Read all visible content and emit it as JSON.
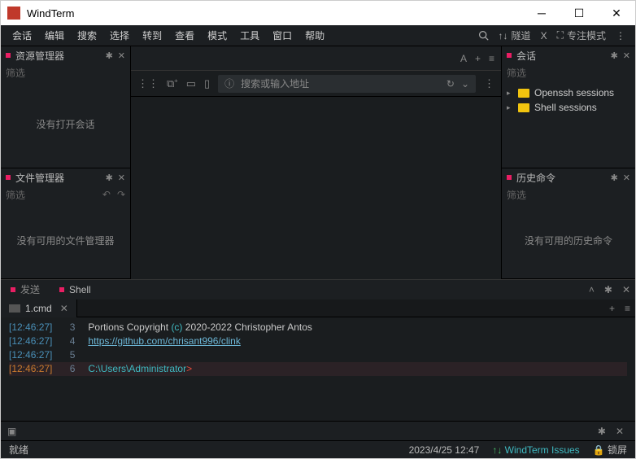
{
  "window": {
    "title": "WindTerm"
  },
  "menu": {
    "items": [
      "会话",
      "编辑",
      "搜索",
      "选择",
      "转到",
      "查看",
      "模式",
      "工具",
      "窗口",
      "帮助"
    ],
    "right": {
      "tunnel": "隧道",
      "x": "X",
      "focus": "专注模式"
    }
  },
  "center_toolbar": {
    "font_indicator": "A"
  },
  "panels": {
    "resource": {
      "title": "资源管理器",
      "filter": "筛选",
      "empty": "没有打开会话"
    },
    "file": {
      "title": "文件管理器",
      "filter": "筛选",
      "empty": "没有可用的文件管理器"
    },
    "sessions": {
      "title": "会话",
      "filter": "筛选",
      "items": [
        "Openssh sessions",
        "Shell sessions"
      ]
    },
    "history": {
      "title": "历史命令",
      "filter": "筛选",
      "empty": "没有可用的历史命令"
    }
  },
  "address": {
    "placeholder": "搜索或输入地址"
  },
  "bottom": {
    "tabs": [
      "发送",
      "Shell"
    ],
    "session_tab": "1.cmd",
    "lines": [
      {
        "ts": "[12:46:27]",
        "n": "3",
        "text": "Portions Copyright ",
        "paren": "(c)",
        "rest": " 2020-2022 Christopher Antos"
      },
      {
        "ts": "[12:46:27]",
        "n": "4",
        "link": "https://github.com/chrisant996/clink"
      },
      {
        "ts": "[12:46:27]",
        "n": "5"
      },
      {
        "ts": "[12:46:27]",
        "n": "6",
        "path": "C:\\Users\\Administrator",
        "prompt": ">"
      }
    ]
  },
  "status": {
    "ready": "就绪",
    "datetime": "2023/4/25 12:47",
    "issues": "WindTerm Issues",
    "lock": "锁屏"
  }
}
